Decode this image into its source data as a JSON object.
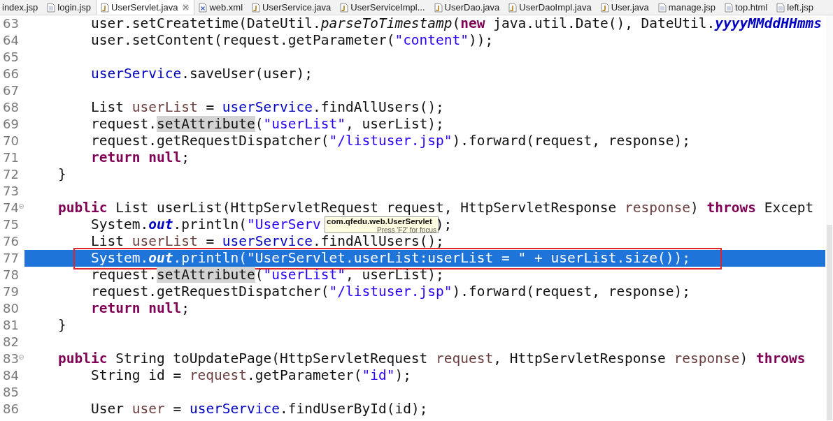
{
  "tabs": [
    {
      "label": "index.jsp",
      "kind": "cut",
      "selected": false,
      "closable": false
    },
    {
      "label": "login.jsp",
      "kind": "page",
      "selected": false,
      "closable": false
    },
    {
      "label": "UserServlet.java",
      "kind": "java",
      "selected": true,
      "closable": true
    },
    {
      "label": "web.xml",
      "kind": "xml",
      "selected": false,
      "closable": false
    },
    {
      "label": "UserService.java",
      "kind": "java",
      "selected": false,
      "closable": false
    },
    {
      "label": "UserServiceImpl...",
      "kind": "java",
      "selected": false,
      "closable": false
    },
    {
      "label": "UserDao.java",
      "kind": "java",
      "selected": false,
      "closable": false
    },
    {
      "label": "UserDaoImpl.java",
      "kind": "java",
      "selected": false,
      "closable": false
    },
    {
      "label": "User.java",
      "kind": "java",
      "selected": false,
      "closable": false
    },
    {
      "label": "manage.jsp",
      "kind": "page",
      "selected": false,
      "closable": false
    },
    {
      "label": "top.html",
      "kind": "page",
      "selected": false,
      "closable": false
    },
    {
      "label": "left.jsp",
      "kind": "page",
      "selected": false,
      "closable": false
    }
  ],
  "editor": {
    "lines": [
      {
        "number": "63",
        "kind": "statement",
        "selected": false,
        "boxed": false,
        "foldable": false,
        "segments": [
          {
            "t": "user.setCreatetime(DateUtil.",
            "kind": "plain"
          },
          {
            "t": "parseToTimestamp",
            "kind": "static"
          },
          {
            "t": "(",
            "kind": "plain"
          },
          {
            "t": "new",
            "kind": "keyword"
          },
          {
            "t": " java.util.Date(), DateUtil.",
            "kind": "plain"
          },
          {
            "t": "yyyyMMddHHmms",
            "kind": "constant"
          }
        ]
      },
      {
        "number": "64",
        "kind": "statement",
        "selected": false,
        "boxed": false,
        "foldable": false,
        "segments": [
          {
            "t": "user.setContent(request.getParameter(",
            "kind": "plain"
          },
          {
            "t": "\"content\"",
            "kind": "string"
          },
          {
            "t": "));",
            "kind": "plain"
          }
        ]
      },
      {
        "number": "65",
        "kind": "blank",
        "selected": false,
        "boxed": false,
        "foldable": false
      },
      {
        "number": "66",
        "kind": "statement",
        "selected": false,
        "boxed": false,
        "foldable": false,
        "segments": [
          {
            "t": "userService",
            "kind": "field"
          },
          {
            "t": ".saveUser(user);",
            "kind": "plain"
          }
        ]
      },
      {
        "number": "67",
        "kind": "blank",
        "selected": false,
        "boxed": false,
        "foldable": false
      },
      {
        "number": "68",
        "kind": "statement",
        "selected": false,
        "boxed": false,
        "foldable": false,
        "segments": [
          {
            "t": "List",
            "kind": "plain"
          },
          {
            "t": " userList",
            "kind": "local"
          },
          {
            "t": " =",
            "kind": "plain"
          },
          {
            "t": " userService",
            "kind": "field"
          },
          {
            "t": ".findAllUsers();",
            "kind": "plain"
          }
        ]
      },
      {
        "number": "69",
        "kind": "statement",
        "selected": false,
        "boxed": false,
        "foldable": false,
        "segments": [
          {
            "t": "request.",
            "kind": "plain"
          },
          {
            "t": "setAttribute",
            "kind": "occurrence"
          },
          {
            "t": "(",
            "kind": "plain"
          },
          {
            "t": "\"userList\"",
            "kind": "string"
          },
          {
            "t": ", userList);",
            "kind": "plain"
          }
        ]
      },
      {
        "number": "70",
        "kind": "statement",
        "selected": false,
        "boxed": false,
        "foldable": false,
        "segments": [
          {
            "t": "request.getRequestDispatcher(",
            "kind": "plain"
          },
          {
            "t": "\"/listuser.jsp\"",
            "kind": "string"
          },
          {
            "t": ").forward(request, response);",
            "kind": "plain"
          }
        ]
      },
      {
        "number": "71",
        "kind": "statement",
        "selected": false,
        "boxed": false,
        "foldable": false,
        "segments": [
          {
            "t": "return null",
            "kind": "keyword"
          },
          {
            "t": ";",
            "kind": "plain"
          }
        ]
      },
      {
        "number": "72",
        "kind": "member",
        "selected": false,
        "boxed": false,
        "foldable": false,
        "segments": [
          {
            "t": "}",
            "kind": "plain"
          }
        ]
      },
      {
        "number": "73",
        "kind": "blank",
        "selected": false,
        "boxed": false,
        "foldable": false
      },
      {
        "number": "74",
        "kind": "member",
        "selected": false,
        "boxed": false,
        "foldable": true,
        "segments": [
          {
            "t": "public",
            "kind": "keyword"
          },
          {
            "t": " List userList(HttpServletRequest request, HttpServletResponse",
            "kind": "plain"
          },
          {
            "t": " response",
            "kind": "local"
          },
          {
            "t": ")",
            "kind": "plain"
          },
          {
            "t": " throws",
            "kind": "keyword"
          },
          {
            "t": " Except",
            "kind": "plain"
          }
        ]
      },
      {
        "number": "75",
        "kind": "statement",
        "selected": false,
        "boxed": false,
        "foldable": false,
        "segments": [
          {
            "t": "System.",
            "kind": "plain"
          },
          {
            "t": "out",
            "kind": "constant"
          },
          {
            "t": ".println(",
            "kind": "plain"
          },
          {
            "t": "\"UserServ",
            "kind": "string"
          },
          {
            "t": ");",
            "kind": "after-tooltip"
          }
        ]
      },
      {
        "number": "76",
        "kind": "statement",
        "selected": false,
        "boxed": false,
        "foldable": false,
        "segments": [
          {
            "t": "List",
            "kind": "plain"
          },
          {
            "t": " userList",
            "kind": "local"
          },
          {
            "t": " =",
            "kind": "plain"
          },
          {
            "t": " userService",
            "kind": "field"
          },
          {
            "t": ".findAllUsers();",
            "kind": "plain"
          }
        ]
      },
      {
        "number": "77",
        "kind": "statement",
        "selected": true,
        "boxed": true,
        "foldable": false,
        "segments": [
          {
            "t": "System.",
            "kind": "plain"
          },
          {
            "t": "out",
            "kind": "constant"
          },
          {
            "t": ".println(",
            "kind": "plain"
          },
          {
            "t": "\"UserServlet.userList:userList = \"",
            "kind": "string"
          },
          {
            "t": " + userList.size());",
            "kind": "plain"
          }
        ]
      },
      {
        "number": "78",
        "kind": "statement",
        "selected": false,
        "boxed": false,
        "foldable": false,
        "segments": [
          {
            "t": "request.",
            "kind": "plain"
          },
          {
            "t": "setAttribute",
            "kind": "occurrence"
          },
          {
            "t": "(",
            "kind": "plain"
          },
          {
            "t": "\"userList\"",
            "kind": "string"
          },
          {
            "t": ", userList);",
            "kind": "plain"
          }
        ]
      },
      {
        "number": "79",
        "kind": "statement",
        "selected": false,
        "boxed": false,
        "foldable": false,
        "segments": [
          {
            "t": "request.getRequestDispatcher(",
            "kind": "plain"
          },
          {
            "t": "\"/listuser.jsp\"",
            "kind": "string"
          },
          {
            "t": ").forward(request, response);",
            "kind": "plain"
          }
        ]
      },
      {
        "number": "80",
        "kind": "statement",
        "selected": false,
        "boxed": false,
        "foldable": false,
        "segments": [
          {
            "t": "return null",
            "kind": "keyword"
          },
          {
            "t": ";",
            "kind": "plain"
          }
        ]
      },
      {
        "number": "81",
        "kind": "member",
        "selected": false,
        "boxed": false,
        "foldable": false,
        "segments": [
          {
            "t": "}",
            "kind": "plain"
          }
        ]
      },
      {
        "number": "82",
        "kind": "blank",
        "selected": false,
        "boxed": false,
        "foldable": false
      },
      {
        "number": "83",
        "kind": "member",
        "selected": false,
        "boxed": false,
        "foldable": true,
        "segments": [
          {
            "t": "public",
            "kind": "keyword"
          },
          {
            "t": " String toUpdatePage(HttpServletRequest",
            "kind": "plain"
          },
          {
            "t": " request",
            "kind": "local"
          },
          {
            "t": ", HttpServletResponse",
            "kind": "plain"
          },
          {
            "t": " response",
            "kind": "local"
          },
          {
            "t": ")",
            "kind": "plain"
          },
          {
            "t": " throws",
            "kind": "keyword"
          }
        ]
      },
      {
        "number": "84",
        "kind": "statement",
        "selected": false,
        "boxed": false,
        "foldable": false,
        "segments": [
          {
            "t": "String id =",
            "kind": "plain"
          },
          {
            "t": " request",
            "kind": "local"
          },
          {
            "t": ".getParameter(",
            "kind": "plain"
          },
          {
            "t": "\"id\"",
            "kind": "string"
          },
          {
            "t": ");",
            "kind": "plain"
          }
        ]
      },
      {
        "number": "85",
        "kind": "blank",
        "selected": false,
        "boxed": false,
        "foldable": false
      },
      {
        "number": "86",
        "kind": "statement",
        "selected": false,
        "boxed": false,
        "foldable": false,
        "segments": [
          {
            "t": "User",
            "kind": "plain"
          },
          {
            "t": " user",
            "kind": "local"
          },
          {
            "t": " =",
            "kind": "plain"
          },
          {
            "t": " userService",
            "kind": "field"
          },
          {
            "t": ".findUserById(id);",
            "kind": "plain"
          }
        ]
      }
    ]
  },
  "tooltip": {
    "title": "com.qfedu.web.UserServlet",
    "hint": "Press 'F2' for focus"
  }
}
